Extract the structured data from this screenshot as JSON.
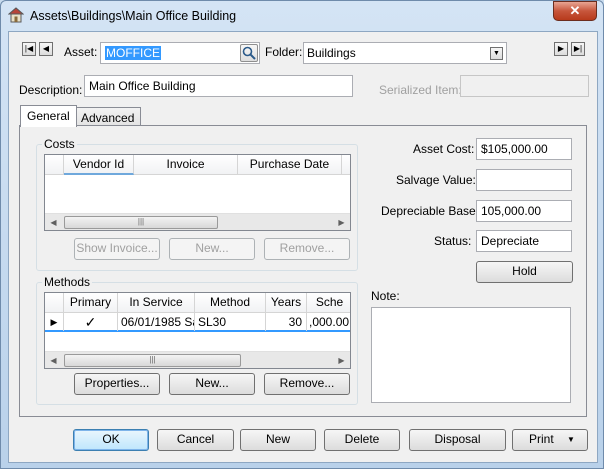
{
  "window": {
    "title": "Assets\\Buildings\\Main Office Building",
    "close_glyph": "✕"
  },
  "header": {
    "asset_label": "Asset:",
    "asset_value": "MOFFICE",
    "folder_label": "Folder:",
    "folder_value": "Buildings",
    "description_label": "Description:",
    "description_value": "Main Office Building",
    "serialized_label": "Serialized Item:",
    "serialized_value": ""
  },
  "tabs": [
    {
      "label": "General"
    },
    {
      "label": "Advanced"
    }
  ],
  "costs": {
    "title": "Costs",
    "columns": [
      "Vendor Id",
      "Invoice",
      "Purchase Date"
    ],
    "rows": [],
    "buttons": {
      "show_invoice": "Show Invoice...",
      "new": "New...",
      "remove": "Remove..."
    }
  },
  "methods": {
    "title": "Methods",
    "columns": [
      "Primary",
      "In Service",
      "Method",
      "Years",
      "Sche"
    ],
    "rows": [
      {
        "primary": "✓",
        "in_service": "06/01/1985 Sa",
        "method": "SL30",
        "years": "30",
        "schedule": ",000.00"
      }
    ],
    "buttons": {
      "properties": "Properties...",
      "new": "New...",
      "remove": "Remove..."
    }
  },
  "values": {
    "asset_cost_label": "Asset Cost:",
    "asset_cost": "$105,000.00",
    "salvage_label": "Salvage Value:",
    "salvage": "",
    "depreciable_label": "Depreciable Base:",
    "depreciable": "105,000.00",
    "status_label": "Status:",
    "status": "Depreciate",
    "hold_button": "Hold",
    "note_label": "Note:",
    "note": ""
  },
  "footer": {
    "ok": "OK",
    "cancel": "Cancel",
    "new": "New",
    "delete": "Delete",
    "disposal": "Disposal",
    "print": "Print"
  },
  "colors": {
    "accent": "#3399ff",
    "selection": "#3399ff"
  }
}
